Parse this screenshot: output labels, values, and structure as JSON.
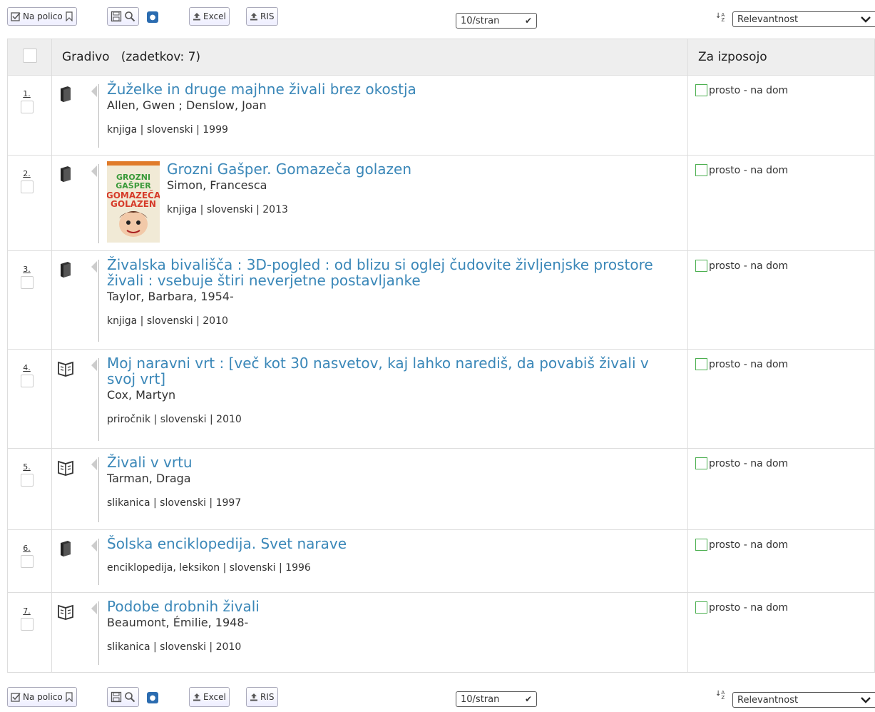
{
  "toolbar": {
    "shelf_label": "Na polico",
    "excel_label": "Excel",
    "ris_label": "RIS",
    "rss_icon": "rss-icon",
    "per_page": "10/stran",
    "sort_value": "Relevantnost"
  },
  "table": {
    "material_header": "Gradivo",
    "hits_label": "(zadetkov: 7)",
    "availability_header": "Za izposojo",
    "rows": [
      {
        "num": "1.",
        "title": "Žuželke in druge majhne živali brez okostja",
        "author": "Allen, Gwen ; Denslow, Joan",
        "meta": "knjiga | slovenski | 1999",
        "avail": "prosto - na dom",
        "icon": "book-icon"
      },
      {
        "num": "2.",
        "title": "Grozni Gašper. Gomazeča golazen",
        "author": "Simon, Francesca",
        "meta": "knjiga | slovenski | 2013",
        "avail": "prosto - na dom",
        "icon": "book-icon",
        "cover_text": "GROZNI GAŠPER GOMAZEČA GOLAZEN"
      },
      {
        "num": "3.",
        "title": "Živalska bivališča : 3D-pogled : od blizu si oglej čudovite življenjske prostore živali : vsebuje štiri neverjetne postavljanke",
        "author": "Taylor, Barbara, 1954-",
        "meta": "knjiga | slovenski | 2010",
        "avail": "prosto - na dom",
        "icon": "book-icon"
      },
      {
        "num": "4.",
        "title": "Moj naravni vrt : [več kot 30 nasvetov, kaj lahko narediš, da povabiš živali v svoj vrt]",
        "author": "Cox, Martyn",
        "meta": "priročnik | slovenski | 2010",
        "avail": "prosto - na dom",
        "icon": "open-book-icon"
      },
      {
        "num": "5.",
        "title": "Živali v vrtu",
        "author": "Tarman, Draga",
        "meta": "slikanica | slovenski | 1997",
        "avail": "prosto - na dom",
        "icon": "open-book-icon"
      },
      {
        "num": "6.",
        "title": "Šolska enciklopedija. Svet narave",
        "author": "",
        "meta": "enciklopedija, leksikon | slovenski | 1996",
        "avail": "prosto - na dom",
        "icon": "book-icon"
      },
      {
        "num": "7.",
        "title": "Podobe drobnih živali",
        "author": "Beaumont, Émilie, 1948-",
        "meta": "slikanica | slovenski | 2010",
        "avail": "prosto - na dom",
        "icon": "open-book-icon"
      }
    ]
  }
}
